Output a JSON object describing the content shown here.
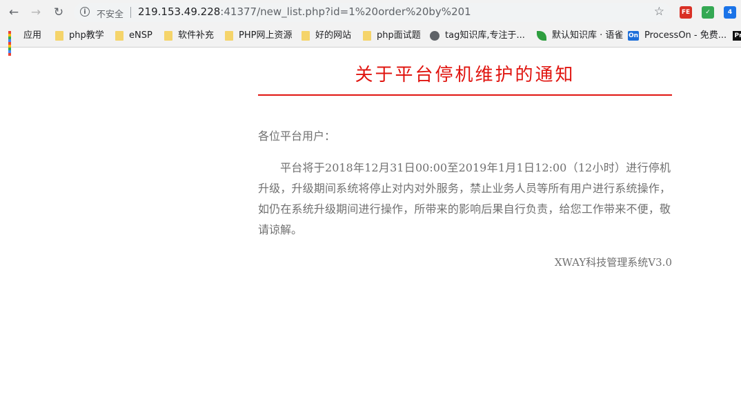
{
  "browser": {
    "security_label": "不安全",
    "url_host": "219.153.49.228",
    "url_rest": ":41377/new_list.php?id=1%20order%20by%201",
    "extensions": [
      {
        "name": "fe-extension-icon",
        "label": "FE",
        "color": "#d93025"
      },
      {
        "name": "shield-extension-icon",
        "label": "✓",
        "color": "#34a853"
      },
      {
        "name": "translate-extension-icon",
        "label": "4",
        "color": "#1a73e8"
      }
    ]
  },
  "bookmarks": [
    {
      "label": "应用",
      "icon": "apps-grid-icon"
    },
    {
      "label": "php教学",
      "icon": "folder-icon"
    },
    {
      "label": "eNSP",
      "icon": "folder-icon"
    },
    {
      "label": "软件补充",
      "icon": "folder-icon"
    },
    {
      "label": "PHP网上资源",
      "icon": "folder-icon"
    },
    {
      "label": "好的网站",
      "icon": "folder-icon"
    },
    {
      "label": "php面试题",
      "icon": "folder-icon"
    },
    {
      "label": "tag知识库,专注于...",
      "icon": "globe-icon"
    },
    {
      "label": "默认知识库 · 语雀",
      "icon": "yuque-icon"
    },
    {
      "label": "ProcessOn - 免费...",
      "icon": "processon-icon"
    },
    {
      "label": "Pr",
      "icon": "pr-icon"
    }
  ],
  "notice": {
    "title": "关于平台停机维护的通知",
    "greeting": "各位平台用户：",
    "body": "平台将于2018年12月31日00:00至2019年1月1日12:00（12小时）进行停机升级，升级期间系统将停止对内对外服务，禁止业务人员等所有用户进行系统操作，如仍在系统升级期间进行操作，所带来的影响后果自行负责，给您工作带来不便，敬请谅解。",
    "signature": "XWAY科技管理系统V3.0"
  }
}
